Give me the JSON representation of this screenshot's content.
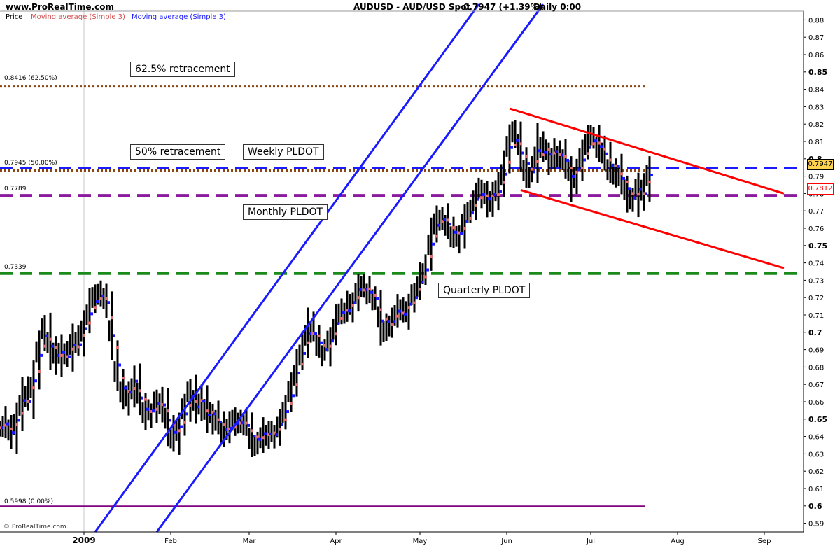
{
  "header": {
    "site": "www.ProRealTime.com",
    "title": "AUDUSD - AUD/USD Spot",
    "price_change": "0.7947 (+1.39%)",
    "timeframe": "Daily 0:00"
  },
  "legend": {
    "price": "Price",
    "ma1": "Moving average (Simple 3)",
    "ma2": "Moving average (Simple 3)"
  },
  "watermark": "© ProRealTime.com",
  "annotations": {
    "fib_625": "62.5% retracement",
    "fib_50": "50% retracement",
    "weekly": "Weekly PLDOT",
    "monthly": "Monthly PLDOT",
    "quarterly": "Quarterly PLDOT",
    "lbl_8416": "0.8416 (62.50%)",
    "lbl_7945": "0.7945 (50.00%)",
    "lbl_7789": "0.7789",
    "lbl_7339": "0.7339",
    "lbl_5998": "0.5998 (0.00%)"
  },
  "price_tags": {
    "last": "0.7947",
    "monthly": "0.7812"
  },
  "colors": {
    "candles": "#000000",
    "ma_pink": "#e07070",
    "ma_blue": "#1a1aff",
    "fib": "#8b4513",
    "weekly": "#1a1aff",
    "monthly": "#8b1a9e",
    "quarterly": "#1a8a1a",
    "channel_blue": "#1a1aff",
    "channel_red": "#ff0000",
    "zero_line": "#800080"
  },
  "chart_data": {
    "type": "bar",
    "yaxis": {
      "range": [
        0.585,
        0.885
      ],
      "ticks": [
        "0.88",
        "0.87",
        "0.86",
        "0.85",
        "0.84",
        "0.83",
        "0.82",
        "0.81",
        "0.8",
        "0.79",
        "0.78",
        "0.77",
        "0.76",
        "0.75",
        "0.74",
        "0.73",
        "0.72",
        "0.71",
        "0.7",
        "0.69",
        "0.68",
        "0.67",
        "0.66",
        "0.65",
        "0.64",
        "0.63",
        "0.62",
        "0.61",
        "0.6",
        "0.59"
      ],
      "bold_ticks": [
        "0.85",
        "0.8",
        "0.75",
        "0.7",
        "0.65",
        "0.6"
      ]
    },
    "xaxis": {
      "labels": [
        {
          "text": "2009",
          "day": 3
        },
        {
          "text": "Feb",
          "day": 34
        },
        {
          "text": "Mar",
          "day": 62
        },
        {
          "text": "Apr",
          "day": 93
        },
        {
          "text": "May",
          "day": 123
        },
        {
          "text": "Jun",
          "day": 154
        },
        {
          "text": "Jul",
          "day": 184
        },
        {
          "text": "Aug",
          "day": 215
        },
        {
          "text": "Sep",
          "day": 246
        }
      ],
      "range_days": [
        -27,
        260
      ]
    },
    "close_series": [
      [
        -27,
        0.645
      ],
      [
        -25,
        0.648
      ],
      [
        -23,
        0.64
      ],
      [
        -21,
        0.652
      ],
      [
        -19,
        0.668
      ],
      [
        -17,
        0.66
      ],
      [
        -15,
        0.676
      ],
      [
        -13,
        0.696
      ],
      [
        -11,
        0.704
      ],
      [
        -9,
        0.688
      ],
      [
        -7,
        0.682
      ],
      [
        -5,
        0.69
      ],
      [
        -3,
        0.686
      ],
      [
        -1,
        0.695
      ],
      [
        1,
        0.694
      ],
      [
        3,
        0.706
      ],
      [
        5,
        0.716
      ],
      [
        7,
        0.721
      ],
      [
        9,
        0.722
      ],
      [
        11,
        0.715
      ],
      [
        13,
        0.688
      ],
      [
        15,
        0.671
      ],
      [
        17,
        0.662
      ],
      [
        19,
        0.665
      ],
      [
        21,
        0.676
      ],
      [
        23,
        0.658
      ],
      [
        25,
        0.65
      ],
      [
        27,
        0.655
      ],
      [
        29,
        0.662
      ],
      [
        31,
        0.658
      ],
      [
        33,
        0.644
      ],
      [
        35,
        0.638
      ],
      [
        37,
        0.648
      ],
      [
        39,
        0.658
      ],
      [
        41,
        0.668
      ],
      [
        43,
        0.654
      ],
      [
        45,
        0.66
      ],
      [
        47,
        0.65
      ],
      [
        49,
        0.652
      ],
      [
        51,
        0.647
      ],
      [
        53,
        0.641
      ],
      [
        55,
        0.645
      ],
      [
        57,
        0.65
      ],
      [
        59,
        0.648
      ],
      [
        61,
        0.645
      ],
      [
        63,
        0.637
      ],
      [
        65,
        0.637
      ],
      [
        67,
        0.644
      ],
      [
        69,
        0.642
      ],
      [
        71,
        0.64
      ],
      [
        73,
        0.65
      ],
      [
        75,
        0.659
      ],
      [
        77,
        0.668
      ],
      [
        79,
        0.683
      ],
      [
        81,
        0.694
      ],
      [
        83,
        0.705
      ],
      [
        85,
        0.699
      ],
      [
        87,
        0.69
      ],
      [
        89,
        0.688
      ],
      [
        91,
        0.698
      ],
      [
        93,
        0.711
      ],
      [
        95,
        0.715
      ],
      [
        97,
        0.712
      ],
      [
        99,
        0.719
      ],
      [
        101,
        0.729
      ],
      [
        103,
        0.725
      ],
      [
        105,
        0.721
      ],
      [
        107,
        0.718
      ],
      [
        109,
        0.7
      ],
      [
        111,
        0.705
      ],
      [
        113,
        0.708
      ],
      [
        115,
        0.715
      ],
      [
        117,
        0.71
      ],
      [
        119,
        0.718
      ],
      [
        121,
        0.723
      ],
      [
        123,
        0.733
      ],
      [
        125,
        0.74
      ],
      [
        127,
        0.758
      ],
      [
        129,
        0.768
      ],
      [
        131,
        0.766
      ],
      [
        133,
        0.76
      ],
      [
        135,
        0.755
      ],
      [
        137,
        0.757
      ],
      [
        139,
        0.768
      ],
      [
        141,
        0.772
      ],
      [
        143,
        0.78
      ],
      [
        145,
        0.781
      ],
      [
        147,
        0.775
      ],
      [
        149,
        0.78
      ],
      [
        151,
        0.783
      ],
      [
        153,
        0.796
      ],
      [
        155,
        0.815
      ],
      [
        157,
        0.813
      ],
      [
        159,
        0.798
      ],
      [
        161,
        0.793
      ],
      [
        163,
        0.791
      ],
      [
        165,
        0.811
      ],
      [
        167,
        0.805
      ],
      [
        169,
        0.8
      ],
      [
        171,
        0.805
      ],
      [
        173,
        0.802
      ],
      [
        175,
        0.797
      ],
      [
        177,
        0.785
      ],
      [
        179,
        0.795
      ],
      [
        181,
        0.804
      ],
      [
        183,
        0.81
      ],
      [
        185,
        0.812
      ],
      [
        187,
        0.805
      ],
      [
        189,
        0.8
      ],
      [
        191,
        0.793
      ],
      [
        193,
        0.795
      ],
      [
        195,
        0.786
      ],
      [
        197,
        0.779
      ],
      [
        199,
        0.775
      ],
      [
        201,
        0.785
      ],
      [
        203,
        0.78
      ],
      [
        205,
        0.7947
      ]
    ],
    "horizontal_levels": [
      {
        "name": "62.5% retracement",
        "value": 0.8416
      },
      {
        "name": "Weekly PLDOT",
        "value": 0.7947
      },
      {
        "name": "50% retracement",
        "value": 0.7945
      },
      {
        "name": "Monthly PLDOT",
        "value": 0.7789
      },
      {
        "name": "Quarterly PLDOT",
        "value": 0.7339
      },
      {
        "name": "0% retracement",
        "value": 0.5998
      }
    ],
    "channels": [
      {
        "color": "blue",
        "from": [
          7,
          0.585
        ],
        "to": [
          144,
          0.889
        ]
      },
      {
        "color": "blue",
        "from": [
          29,
          0.585
        ],
        "to": [
          167,
          0.889
        ]
      },
      {
        "color": "red",
        "from": [
          155,
          0.829
        ],
        "to": [
          253,
          0.78
        ]
      },
      {
        "color": "red",
        "from": [
          159,
          0.782
        ],
        "to": [
          253,
          0.737
        ]
      }
    ]
  }
}
